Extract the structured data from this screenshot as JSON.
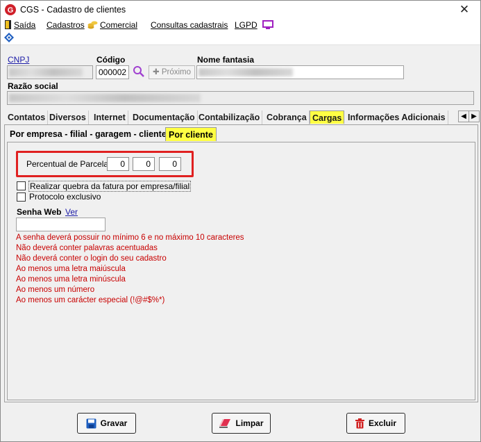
{
  "window": {
    "title": "CGS - Cadastro de clientes",
    "close_glyph": "✕"
  },
  "menu": {
    "items": [
      {
        "label": "Saída",
        "icon": "exit-door-icon"
      },
      {
        "label": "Cadastros"
      },
      {
        "label": "Comercial",
        "icon": "coins-icon"
      },
      {
        "label": "Consultas cadastrais"
      },
      {
        "label": "LGPD",
        "icon": "monitor-icon"
      }
    ]
  },
  "header": {
    "cnpj_label": "CNPJ",
    "codigo_label": "Código",
    "codigo_value": "000002",
    "proximo_label": "Próximo",
    "nome_fantasia_label": "Nome fantasia",
    "razao_social_label": "Razão social"
  },
  "tabs": [
    {
      "label": "Contatos"
    },
    {
      "label": "Diversos"
    },
    {
      "label": "Internet"
    },
    {
      "label": "Documentação"
    },
    {
      "label": "Contabilização"
    },
    {
      "label": "Cobrança"
    },
    {
      "label": "Cargas",
      "active": true
    },
    {
      "label": "Informações Adicionais"
    }
  ],
  "subtabs": [
    {
      "label": "Por empresa - filial - garagem - cliente"
    },
    {
      "label": "Por cliente",
      "active": true
    }
  ],
  "cargas": {
    "percentual_label": "Percentual de Parcelas",
    "parcelas": [
      "0",
      "0",
      "0"
    ],
    "quebra_fatura_label": "Realizar quebra da fatura por empresa/filial",
    "quebra_fatura_checked": false,
    "protocolo_label": "Protocolo exclusivo",
    "protocolo_checked": false,
    "senha_web_label": "Senha Web",
    "ver_link": "Ver",
    "senha_web_value": "",
    "password_rules": [
      "A senha deverá possuir no mínimo 6 e no máximo 10 caracteres",
      "Não deverá conter palavras acentuadas",
      "Não deverá conter o login do seu cadastro",
      "Ao menos uma letra maiúscula",
      "Ao menos uma letra minúscula",
      "Ao menos um número",
      "Ao menos um carácter especial (!@#$%*)"
    ]
  },
  "buttons": {
    "gravar": "Gravar",
    "limpar": "Limpar",
    "excluir": "Excluir"
  },
  "colors": {
    "active_tab": "#ffff44",
    "rule_text": "#c80000",
    "highlight_border": "#e02020",
    "link": "#1a1aa6"
  }
}
